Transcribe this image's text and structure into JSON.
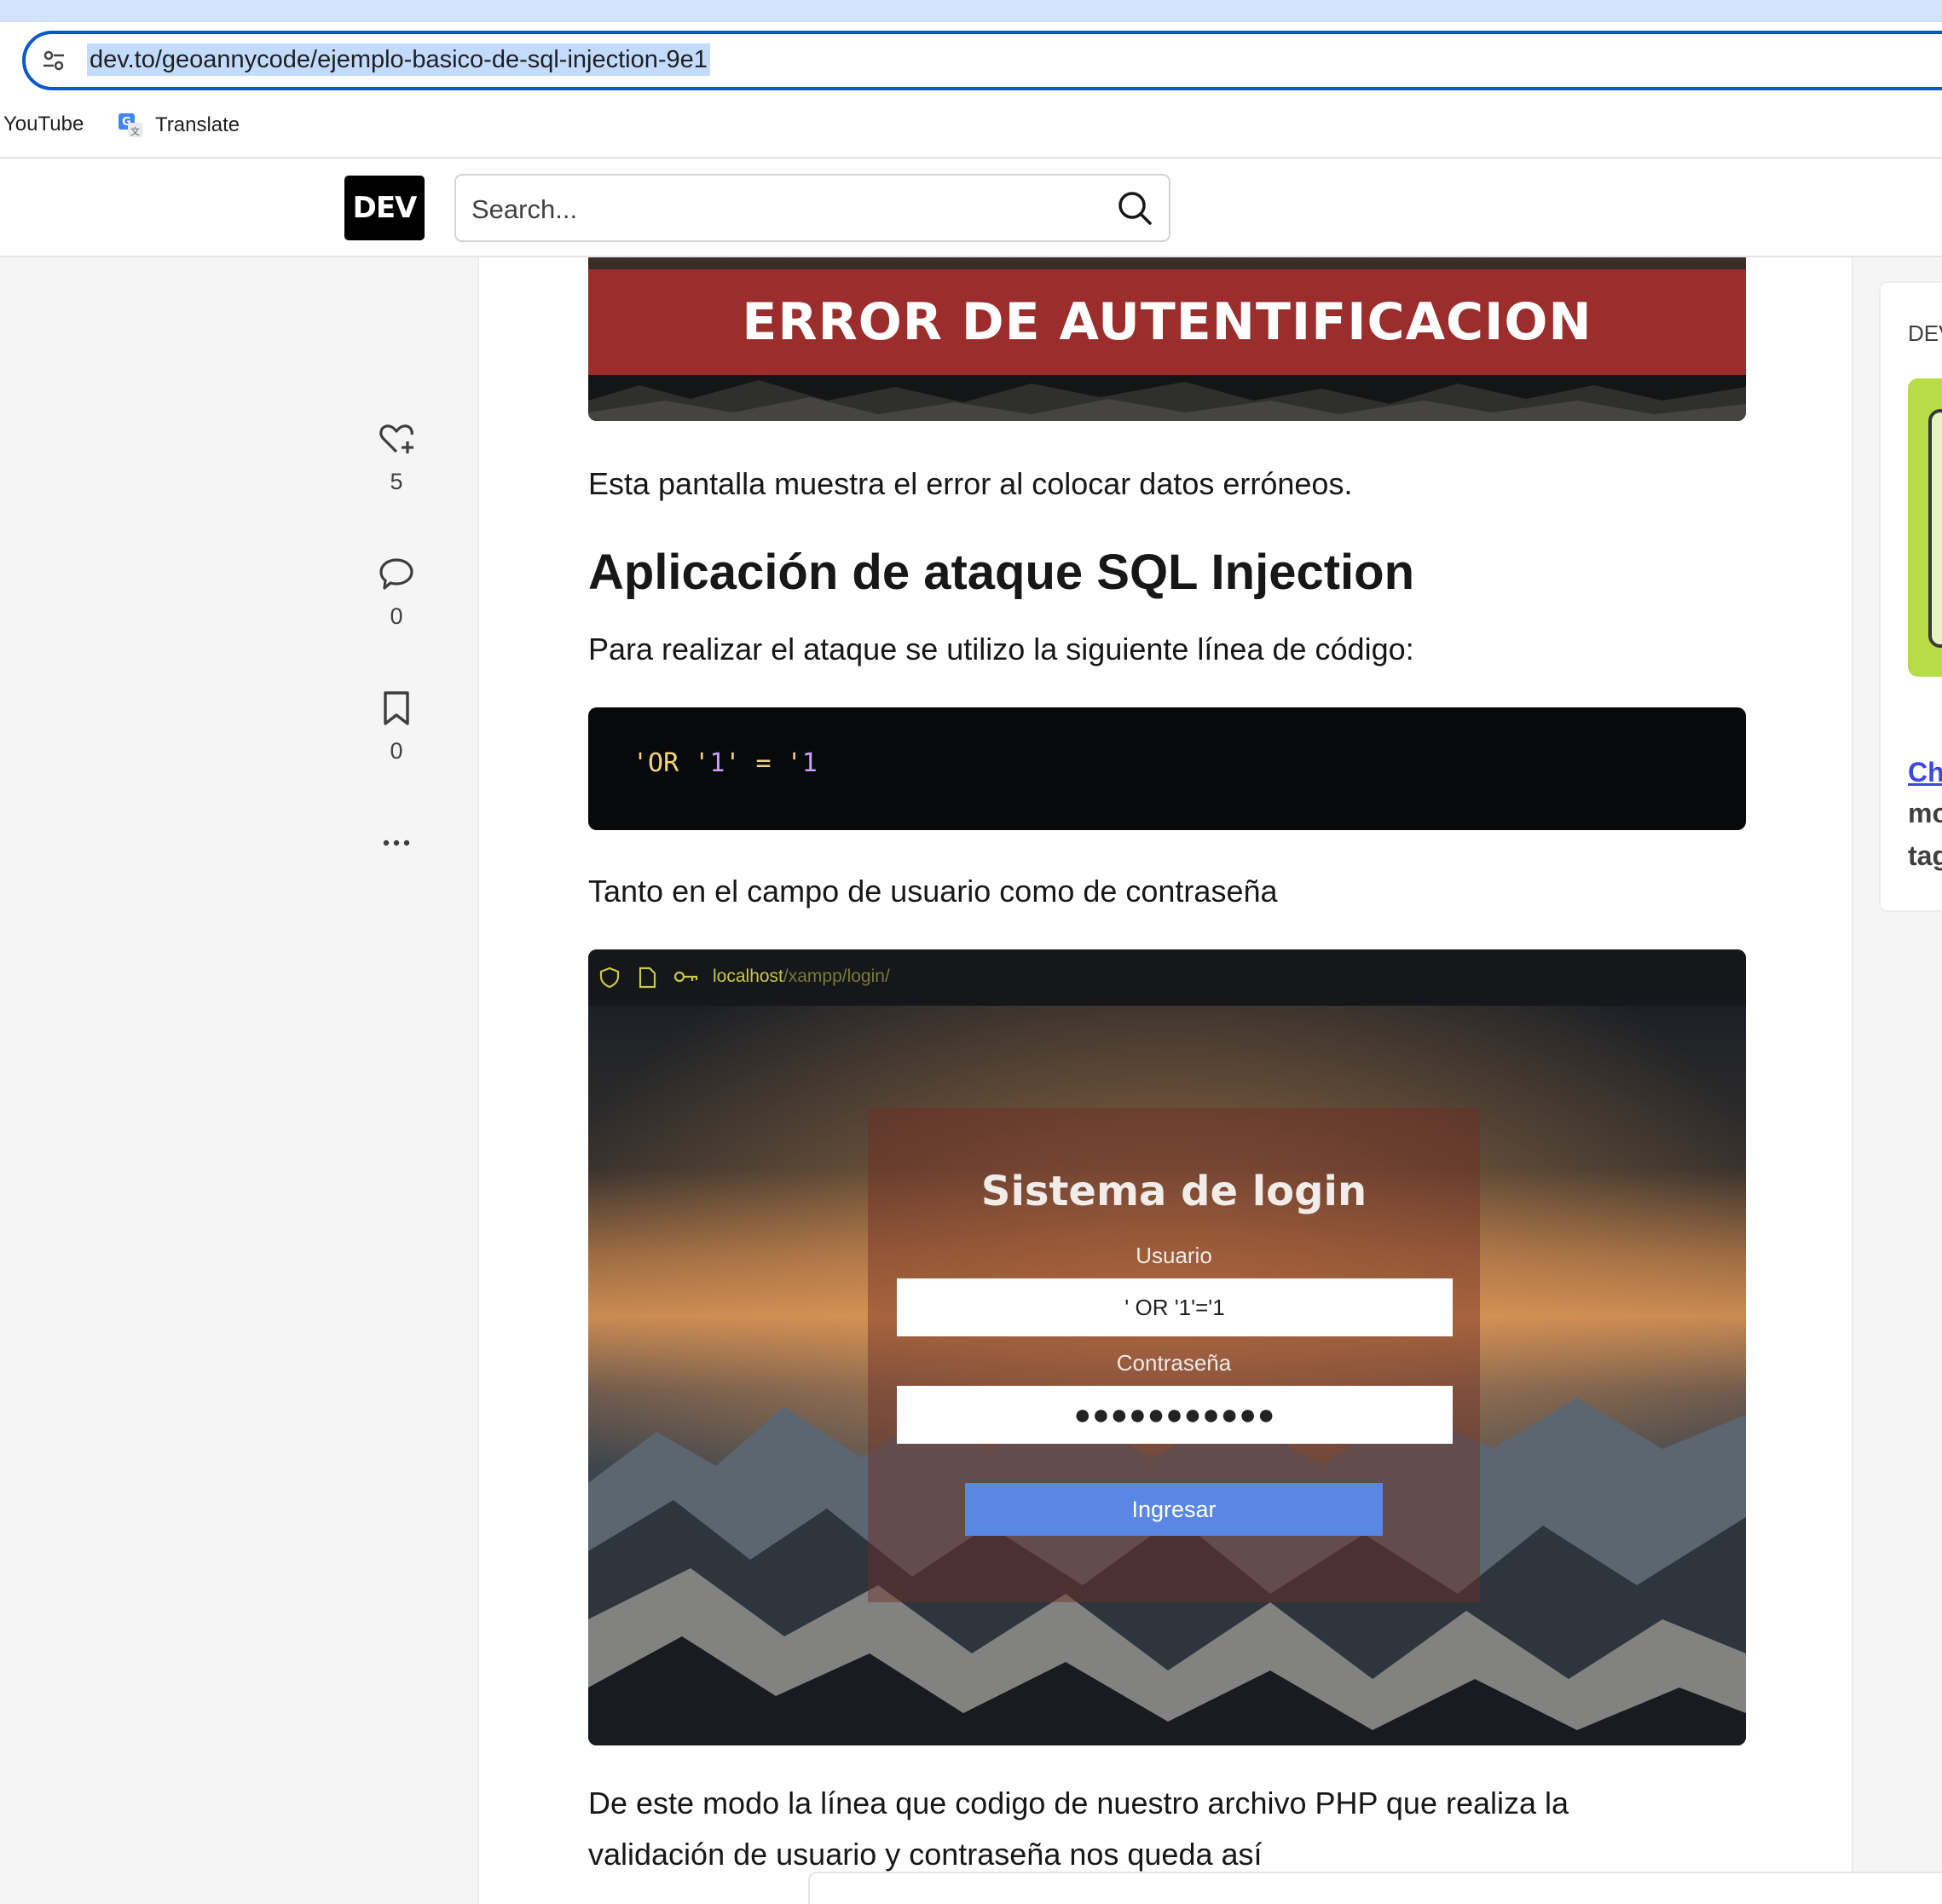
{
  "browser": {
    "url": "dev.to/geoannycode/ejemplo-basico-de-sql-injection-9e1",
    "bookmarks": [
      {
        "label": "YouTube"
      },
      {
        "label": "Translate",
        "icon": "google-translate-icon"
      }
    ]
  },
  "header": {
    "logo": "DEV",
    "search_placeholder": "Search..."
  },
  "reactions": {
    "likes": "5",
    "comments": "0",
    "bookmarks": "0"
  },
  "article": {
    "error_image_text": "ERROR DE AUTENTIFICACION",
    "p1": "Esta pantalla muestra el error al colocar datos erróneos.",
    "h2": "Aplicación de ataque SQL Injection",
    "p2": "Para realizar el ataque se utilizo la siguiente línea de código:",
    "code": {
      "part1": "'OR '",
      "part2": "1",
      "part3": "' = '",
      "part4": "1"
    },
    "p3": "Tanto en el campo de usuario como de contraseña",
    "login_image": {
      "url_host": "localhost",
      "url_path": "/xampp/login/",
      "title": "Sistema de login",
      "user_label": "Usuario",
      "user_value": "' OR '1'='1",
      "pass_label": "Contraseña",
      "pass_value": "●●●●●●●●●●●",
      "button": "Ingresar"
    },
    "p4": "De este modo la línea que codigo de nuestro archivo PHP que realiza la",
    "p5": "validación de usuario y contraseña nos queda así"
  },
  "sidebar": {
    "label": "DEV",
    "link": "Ch",
    "line1": "mo",
    "line2": "tag"
  },
  "colors": {
    "accent": "#0b57d0",
    "dev_link": "#3b49df",
    "error_band": "#9b2e2c",
    "code_bg": "#08090a",
    "login_button": "#5a86e4"
  }
}
